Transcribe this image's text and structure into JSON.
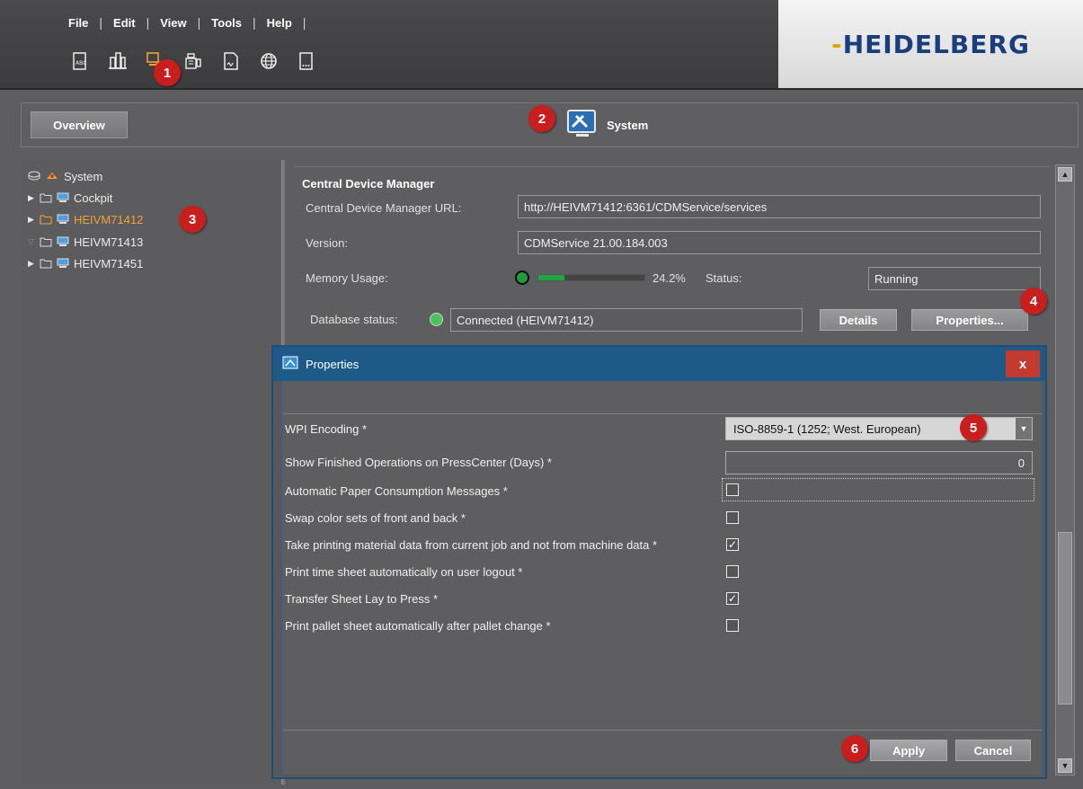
{
  "menu": [
    "File",
    "Edit",
    "View",
    "Tools",
    "Help"
  ],
  "toolbar_icons": [
    "document-abc-icon",
    "columns-icon",
    "system-settings-icon",
    "device-config-icon",
    "signature-document-icon",
    "globe-icon",
    "document-dots-icon"
  ],
  "logo": {
    "left": "H",
    "mid": "EIDELB",
    "right": "ERG"
  },
  "header": {
    "overview_label": "Overview",
    "system_label": "System"
  },
  "tree": {
    "root": "System",
    "items": [
      {
        "label": "Cockpit",
        "selected": false
      },
      {
        "label": "HEIVM71412",
        "selected": true
      },
      {
        "label": "HEIVM71413",
        "selected": false
      },
      {
        "label": "HEIVM71451",
        "selected": false
      }
    ]
  },
  "cdm": {
    "title": "Central Device Manager",
    "url_label": "Central Device Manager URL:",
    "url_value": "http://HEIVM71412:6361/CDMService/services",
    "version_label": "Version:",
    "version_value": "CDMService 21.00.184.003",
    "memory_label": "Memory Usage:",
    "memory_value": "24.2%",
    "memory_fraction": 0.242,
    "status_label": "Status:",
    "status_value": "Running",
    "db_label": "Database status:",
    "db_value": "Connected (HEIVM71412)",
    "details_label": "Details",
    "properties_label": "Properties..."
  },
  "dialog": {
    "title": "Properties",
    "close_label": "x",
    "properties": [
      {
        "label": "WPI Encoding *",
        "type": "select",
        "value": "ISO-8859-1 (1252; West. European)"
      },
      {
        "label": "Show Finished Operations on PressCenter (Days) *",
        "type": "number",
        "value": "0"
      },
      {
        "label": "Automatic Paper Consumption Messages *",
        "type": "checkbox",
        "checked": false
      },
      {
        "label": "Swap color sets of front and back *",
        "type": "checkbox",
        "checked": false
      },
      {
        "label": "Take printing material data from current job and not from machine data *",
        "type": "checkbox",
        "checked": true
      },
      {
        "label": "Print time sheet automatically on user logout *",
        "type": "checkbox",
        "checked": false
      },
      {
        "label": "Transfer Sheet Lay to Press *",
        "type": "checkbox",
        "checked": true
      },
      {
        "label": "Print pallet sheet automatically after pallet change *",
        "type": "checkbox",
        "checked": false
      }
    ],
    "apply_label": "Apply",
    "cancel_label": "Cancel"
  },
  "badges": [
    "1",
    "2",
    "3",
    "4",
    "5",
    "6"
  ],
  "colors": {
    "badge": "#c81e1e",
    "selected_tree": "#f2a232",
    "titlebar": "#1e5a87",
    "close": "#c33a2f"
  }
}
